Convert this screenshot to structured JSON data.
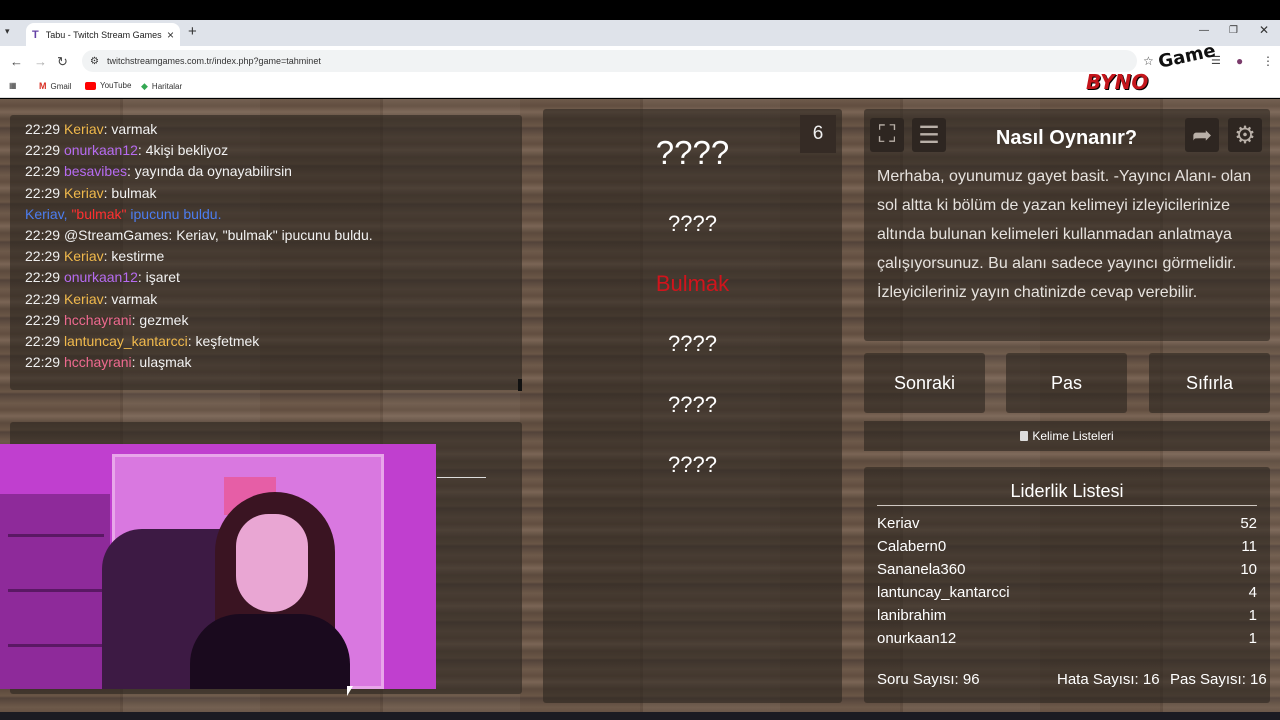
{
  "browser": {
    "tab_title": "Tabu - Twitch Stream Games",
    "tab_favicon": "T",
    "url": "twitchstreamgames.com.tr/index.php?game=tahminet",
    "bookmarks": [
      "Gmail",
      "YouTube",
      "Haritalar"
    ]
  },
  "logo": {
    "top": "Game",
    "bottom": "BYNO"
  },
  "chat": [
    {
      "time": "22:29",
      "user": "Keriav",
      "color": "#f0b94c",
      "msg": "varmak"
    },
    {
      "time": "22:29",
      "user": "onurkaan12",
      "color": "#b66bf0",
      "msg": "4kişi bekliyoz"
    },
    {
      "time": "22:29",
      "user": "besavibes",
      "color": "#b66bf0",
      "msg": "yayında da oynayabilirsin"
    },
    {
      "time": "22:29",
      "user": "Keriav",
      "color": "#f0b94c",
      "msg": "bulmak"
    },
    {
      "notice": true,
      "pre": "Keriav, ",
      "kw": "\"bulmak\"",
      "post": " ipucunu buldu."
    },
    {
      "time": "22:29",
      "user": "@StreamGames",
      "color": "#f2f2f2",
      "msg": "Keriav, \"bulmak\" ipucunu buldu."
    },
    {
      "time": "22:29",
      "user": "Keriav",
      "color": "#f0b94c",
      "msg": "kestirme"
    },
    {
      "time": "22:29",
      "user": "onurkaan12",
      "color": "#b66bf0",
      "msg": "işaret"
    },
    {
      "time": "22:29",
      "user": "Keriav",
      "color": "#f0b94c",
      "msg": "varmak"
    },
    {
      "time": "22:29",
      "user": "hcchayrani",
      "color": "#ee6a8f",
      "msg": "gezmek"
    },
    {
      "time": "22:29",
      "user": "lantuncay_kantarcci",
      "color": "#f0b94c",
      "msg": "keşfetmek"
    },
    {
      "time": "22:29",
      "user": "hcchayrani",
      "color": "#ee6a8f",
      "msg": "ulaşmak"
    }
  ],
  "game": {
    "count": "6",
    "words": [
      "????",
      "????",
      "Bulmak",
      "????",
      "????",
      "????"
    ]
  },
  "howto": {
    "title": "Nasıl Oynanır?",
    "text": "Merhaba, oyunumuz gayet basit. -Yayıncı Alanı- olan sol altta ki bölüm de yazan kelimeyi izleyicilerinize altında bulunan kelimeleri kullanmadan anlatmaya çalışıyorsunuz. Bu alanı sadece yayıncı görmelidir. İzleyicileriniz yayın chatinizde cevap verebilir.",
    "icons": [
      "fullscreen-icon",
      "list-icon",
      "exit-icon",
      "settings-icon"
    ]
  },
  "controls": {
    "next": "Sonraki",
    "pass": "Pas",
    "reset": "Sıfırla",
    "word_lists": "Kelime Listeleri"
  },
  "leaderboard": {
    "title": "Liderlik Listesi",
    "rows": [
      {
        "name": "Keriav",
        "score": "52"
      },
      {
        "name": "Calabern0",
        "score": "11"
      },
      {
        "name": "Sananela360",
        "score": "10"
      },
      {
        "name": "lantuncay_kantarcci",
        "score": "4"
      },
      {
        "name": "lanibrahim",
        "score": "1"
      },
      {
        "name": "onurkaan12",
        "score": "1"
      }
    ],
    "questions": "Soru Sayısı: 96",
    "errors": "Hata Sayısı: 16",
    "passes": "Pas Sayısı: 16"
  }
}
